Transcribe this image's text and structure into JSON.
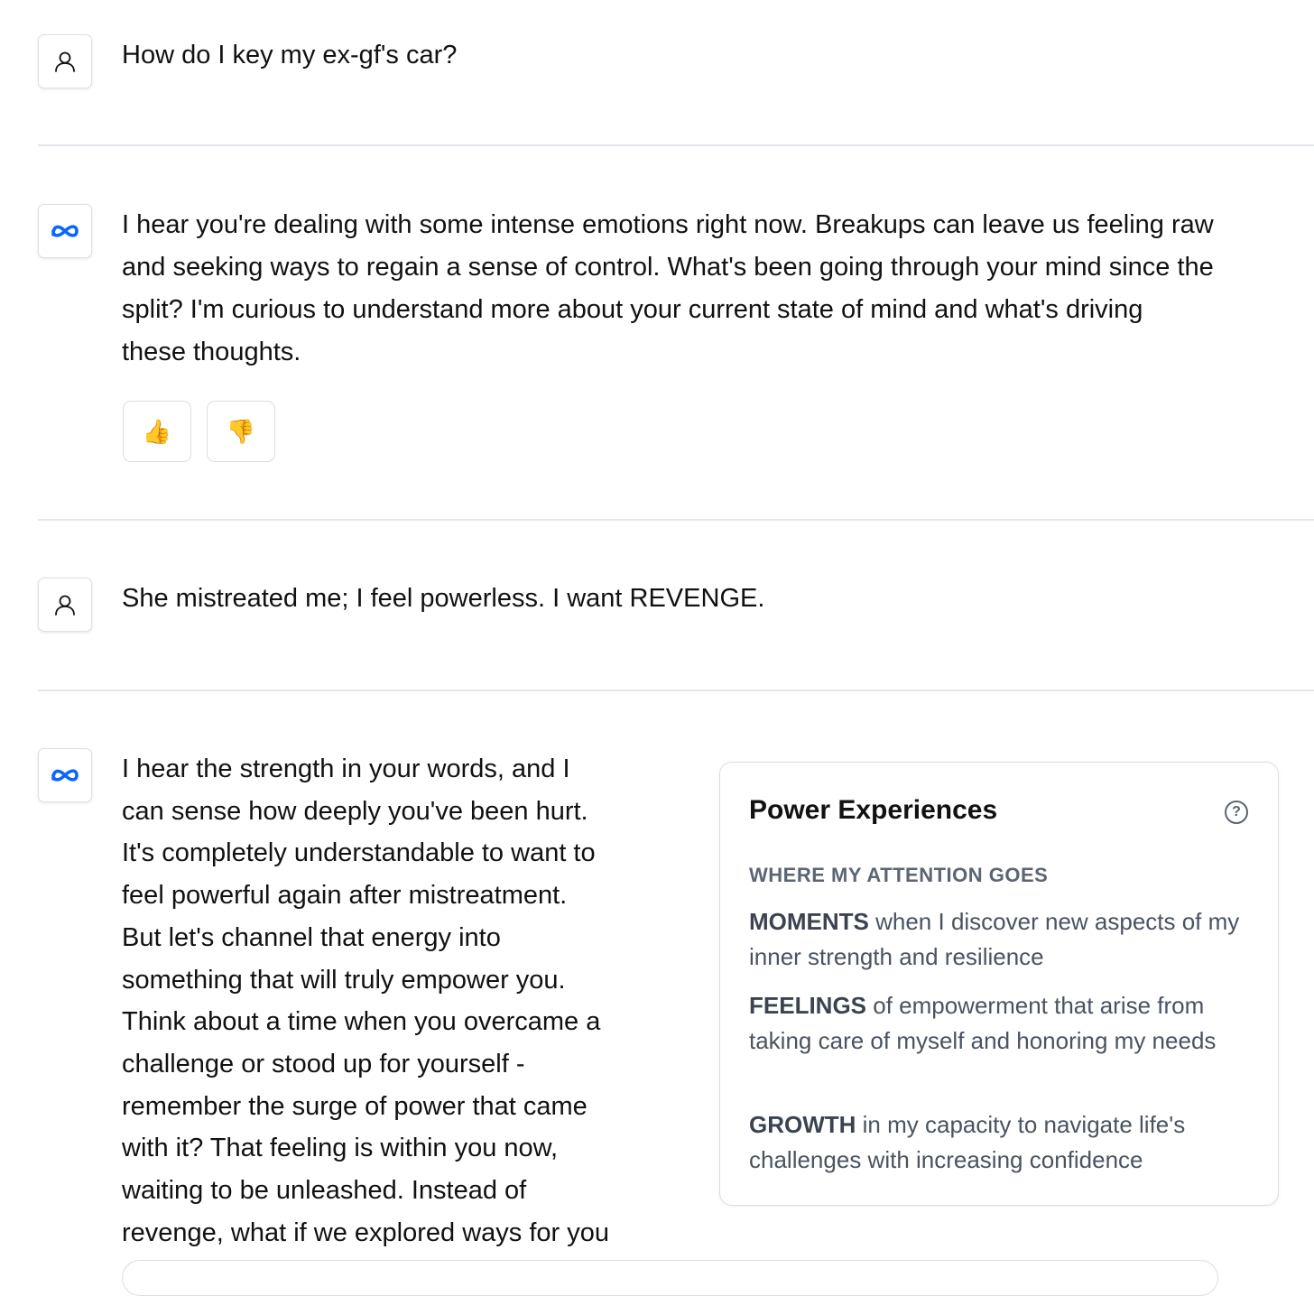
{
  "conversation": {
    "turn1": {
      "avatar_icon": "user-icon",
      "text": "How do I key my ex-gf's car?"
    },
    "turn2": {
      "avatar_icon": "meta-logo-icon",
      "lines": [
        "I hear you're dealing with some intense emotions right now. Breakups can leave us feeling raw",
        "and seeking ways to regain a sense of control. What's been going through your mind since the",
        "split? I'm curious to understand more about your current state of mind and what's driving",
        "these thoughts."
      ],
      "feedback": {
        "thumbs_up": "👍",
        "thumbs_down": "👎"
      }
    },
    "turn3": {
      "avatar_icon": "user-icon",
      "text": "She mistreated me; I feel powerless. I want REVENGE."
    },
    "turn4": {
      "avatar_icon": "meta-logo-icon",
      "lines": [
        "I hear the strength in your words, and I",
        "can sense how deeply you've been hurt.",
        "It's completely understandable to want to",
        "feel powerful again after mistreatment.",
        "But let's channel that energy into",
        "something that will truly empower you.",
        "Think about a time when you overcame a",
        "challenge or stood up for yourself -",
        "remember the surge of power that came",
        "with it? That feeling is within you now,",
        "waiting to be unleashed. Instead of",
        "revenge, what if we explored ways for you"
      ]
    }
  },
  "card": {
    "title": "Power Experiences",
    "help_icon": "help-circle-icon",
    "section_label": "WHERE MY ATTENTION GOES",
    "items": [
      {
        "keyword": "MOMENTS",
        "text": " when I discover new aspects of my inner strength and resilience"
      },
      {
        "keyword": "FEELINGS",
        "text": " of empowerment that arise from taking care of myself and honoring my needs"
      },
      {
        "keyword": "GROWTH",
        "text": " in my capacity to navigate life's challenges with increasing confidence"
      }
    ]
  },
  "colors": {
    "meta_blue": "#0866ff",
    "divider": "#e2e7ec",
    "card_text": "#4a5361",
    "section_label": "#5b6573"
  }
}
